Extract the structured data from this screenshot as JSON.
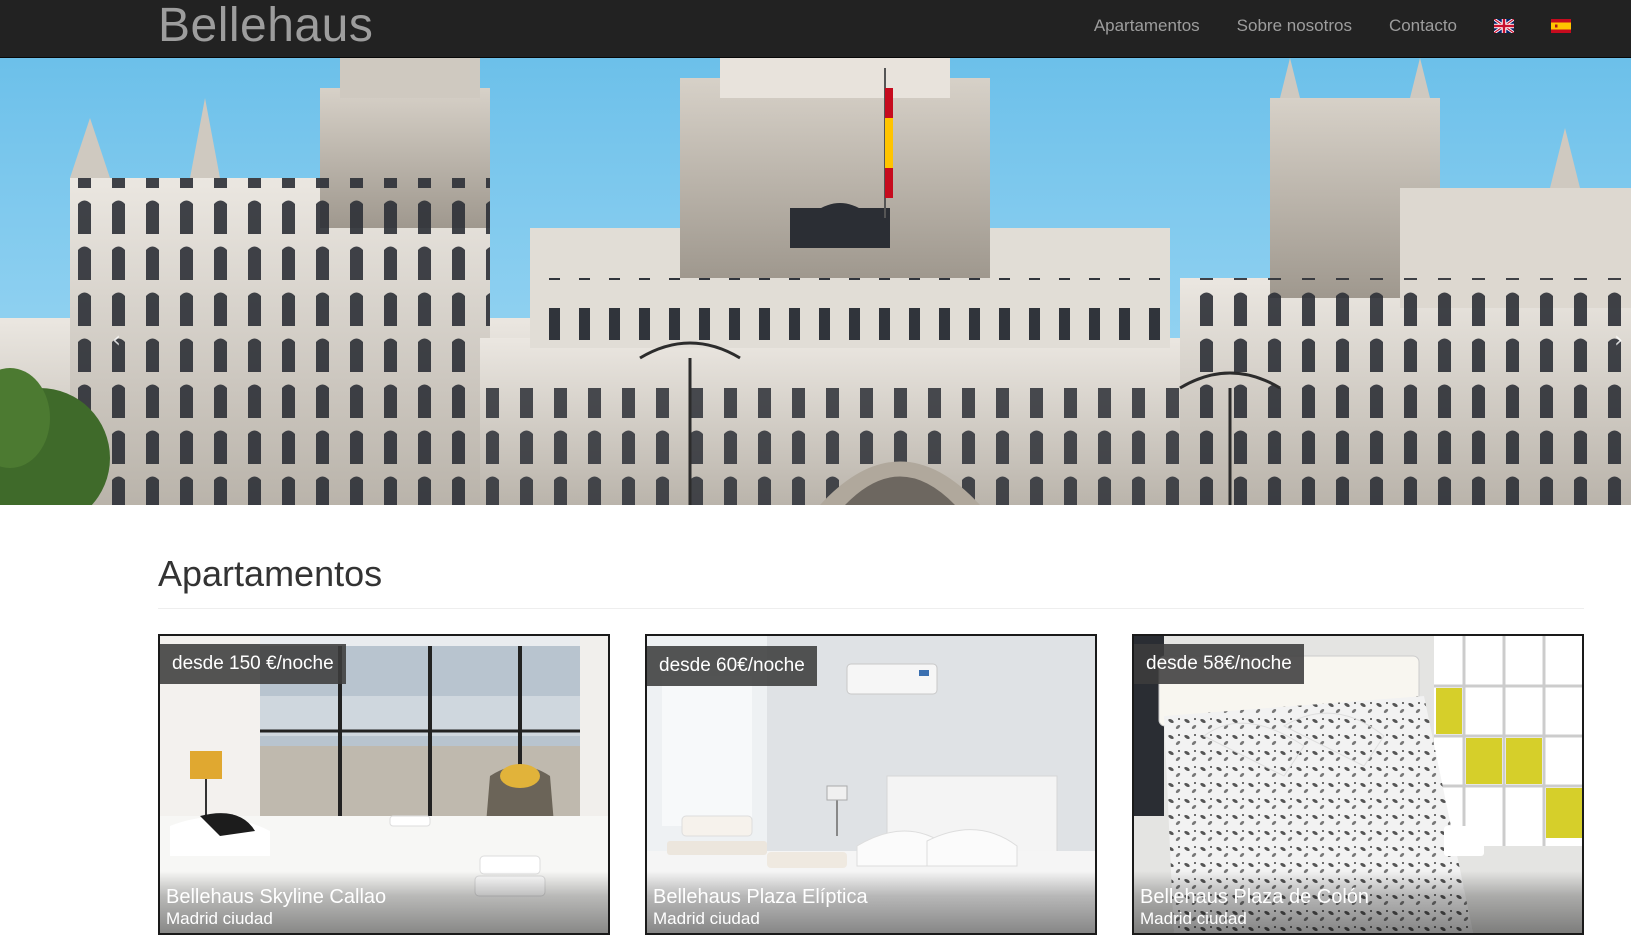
{
  "navbar": {
    "brand": "Bellehaus",
    "links": [
      "Apartamentos",
      "Sobre nosotros",
      "Contacto"
    ],
    "flags": [
      "uk-flag-icon",
      "spain-flag-icon"
    ]
  },
  "hero": {
    "prev_icon": "‹",
    "next_icon": "›"
  },
  "section": {
    "title": "Apartamentos"
  },
  "cards": [
    {
      "price": "desde 150 €/noche",
      "title": "Bellehaus Skyline Callao",
      "subtitle": "Madrid ciudad"
    },
    {
      "price": "desde 60€/noche",
      "title": "Bellehaus Plaza Elíptica",
      "subtitle": "Madrid ciudad"
    },
    {
      "price": "desde 58€/noche",
      "title": "Bellehaus Plaza de Colón",
      "subtitle": "Madrid ciudad"
    }
  ],
  "colors": {
    "navbar_bg": "#222222",
    "nav_text": "#9d9d9d",
    "sky": "#5bb4e0",
    "stone": "#d8d3cc"
  }
}
